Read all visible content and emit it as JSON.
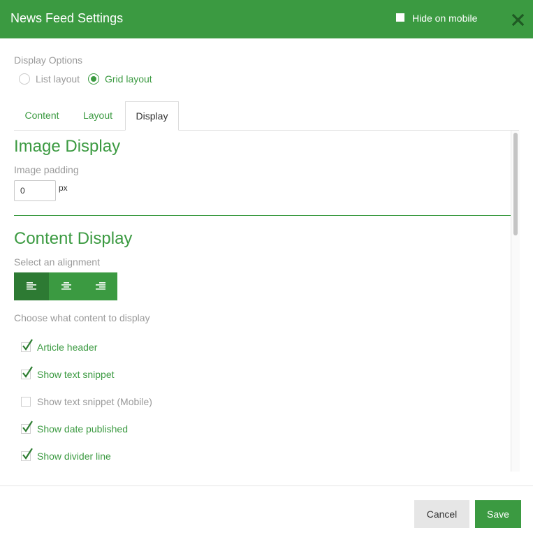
{
  "header": {
    "title": "News Feed Settings",
    "hide_on_mobile_label": "Hide on mobile",
    "hide_on_mobile_checked": false
  },
  "display_options": {
    "label": "Display Options",
    "options": [
      {
        "label": "List layout",
        "selected": false
      },
      {
        "label": "Grid layout",
        "selected": true
      }
    ]
  },
  "tabs": [
    {
      "label": "Content",
      "active": false
    },
    {
      "label": "Layout",
      "active": false
    },
    {
      "label": "Display",
      "active": true
    }
  ],
  "image_display": {
    "heading": "Image Display",
    "padding_label": "Image padding",
    "padding_value": "0",
    "padding_unit": "px"
  },
  "content_display": {
    "heading": "Content Display",
    "alignment_label": "Select an alignment",
    "alignment_options": [
      "left",
      "center",
      "right"
    ],
    "alignment_selected": "left",
    "choose_label": "Choose what content to display",
    "items": [
      {
        "label": "Article header",
        "checked": true
      },
      {
        "label": "Show text snippet",
        "checked": true
      },
      {
        "label": "Show text snippet (Mobile)",
        "checked": false
      },
      {
        "label": "Show date published",
        "checked": true
      },
      {
        "label": "Show divider line",
        "checked": true
      }
    ]
  },
  "footer": {
    "cancel_label": "Cancel",
    "save_label": "Save"
  },
  "colors": {
    "accent": "#3b9a41",
    "accent_dark": "#2d7a33",
    "muted_text": "#9a9a9a"
  },
  "icons": {
    "close": "close-icon",
    "align_left": "align-left-icon",
    "align_center": "align-center-icon",
    "align_right": "align-right-icon",
    "check": "checkmark-icon"
  }
}
